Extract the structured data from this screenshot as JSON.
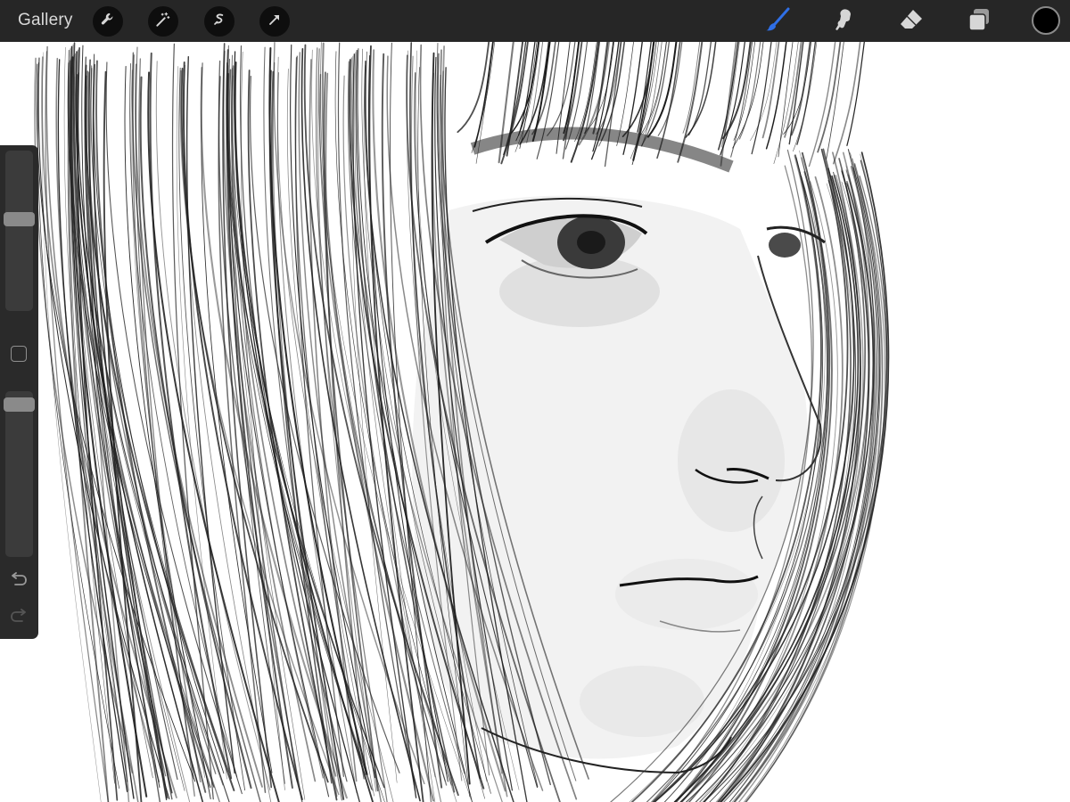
{
  "topbar": {
    "gallery_label": "Gallery",
    "left_tools": [
      "wrench-icon",
      "magic-wand-icon",
      "selection-icon",
      "transform-arrow-icon"
    ],
    "right_tools": [
      "brush-icon",
      "smudge-icon",
      "eraser-icon",
      "layers-icon"
    ],
    "active_tool": "brush-icon"
  },
  "colors": {
    "toolbar_bg": "#262626",
    "active_tool": "#2f6fe6",
    "inactive_tool": "#d6d6d6",
    "current_color": "#000000",
    "sidebar_bg": "#2a2a2a"
  },
  "sidebar": {
    "brush_size_level": 0.58,
    "opacity_level": 0.96,
    "controls": [
      "brush-size-slider",
      "modify-button",
      "opacity-slider",
      "undo-button",
      "redo-button"
    ]
  }
}
